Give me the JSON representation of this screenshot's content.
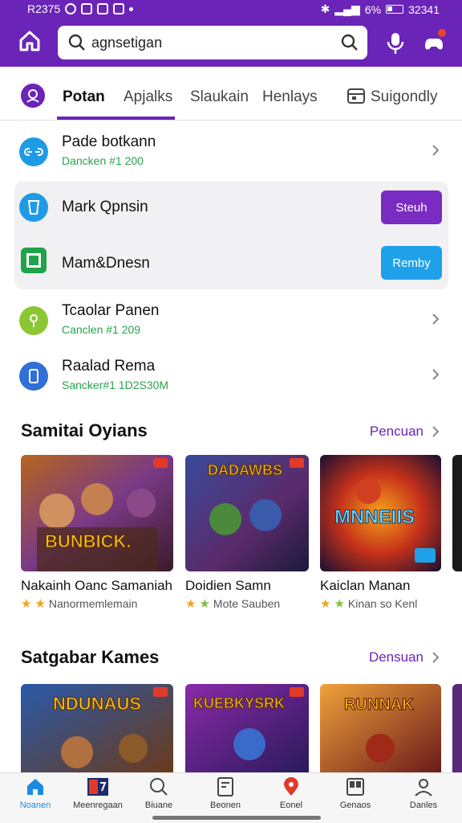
{
  "status": {
    "time_left": "R2375",
    "battery": "6%",
    "time_right": "32341"
  },
  "search": {
    "query": "agnsetigan"
  },
  "tabs": [
    {
      "label": "Potan"
    },
    {
      "label": "Apjalks"
    },
    {
      "label": "Slaukain"
    },
    {
      "label": "Henlays"
    },
    {
      "label": "Suigondly"
    }
  ],
  "list": [
    {
      "title": "Pade botkann",
      "sub": "Dancken #1 200"
    },
    {
      "title": "Mark Qpnsin",
      "button": "Steuh"
    },
    {
      "title": "Mam&Dnesn",
      "button": "Remby"
    },
    {
      "title": "Tcaolar Panen",
      "sub": "Canclen #1 209"
    },
    {
      "title": "Raalad Rema",
      "sub": "Sancker#1 1D2S30M"
    }
  ],
  "section1": {
    "title": "Samitai Oyians",
    "link": "Pencuan",
    "cards": [
      {
        "art_text": "BUNBICK.",
        "title": "Nakainh Oanc Samaniah",
        "rating": "Nanormemlemain"
      },
      {
        "art_text": "DADAWBS",
        "title": "Doidien Samn",
        "rating": "Mote Sauben"
      },
      {
        "art_text": "MNNEIIS",
        "title": "Kaiclan Manan",
        "rating": "Kinan so Kenl"
      }
    ]
  },
  "section2": {
    "title": "Satgabar Kames",
    "link": "Densuan",
    "cards": [
      {
        "art_text": "NDUNAUS"
      },
      {
        "art_text": "KUEBKYSRK"
      },
      {
        "art_text": "RUNNAK"
      }
    ]
  },
  "bottom_nav": [
    {
      "label": "Noanen"
    },
    {
      "label": "Meenregaan"
    },
    {
      "label": "Biuane"
    },
    {
      "label": "Beonen"
    },
    {
      "label": "Eonel"
    },
    {
      "label": "Genaos"
    },
    {
      "label": "Danles"
    }
  ],
  "colors": {
    "brand": "#6a24b8",
    "accent_blue": "#1a8be0",
    "green": "#2aa34a"
  }
}
